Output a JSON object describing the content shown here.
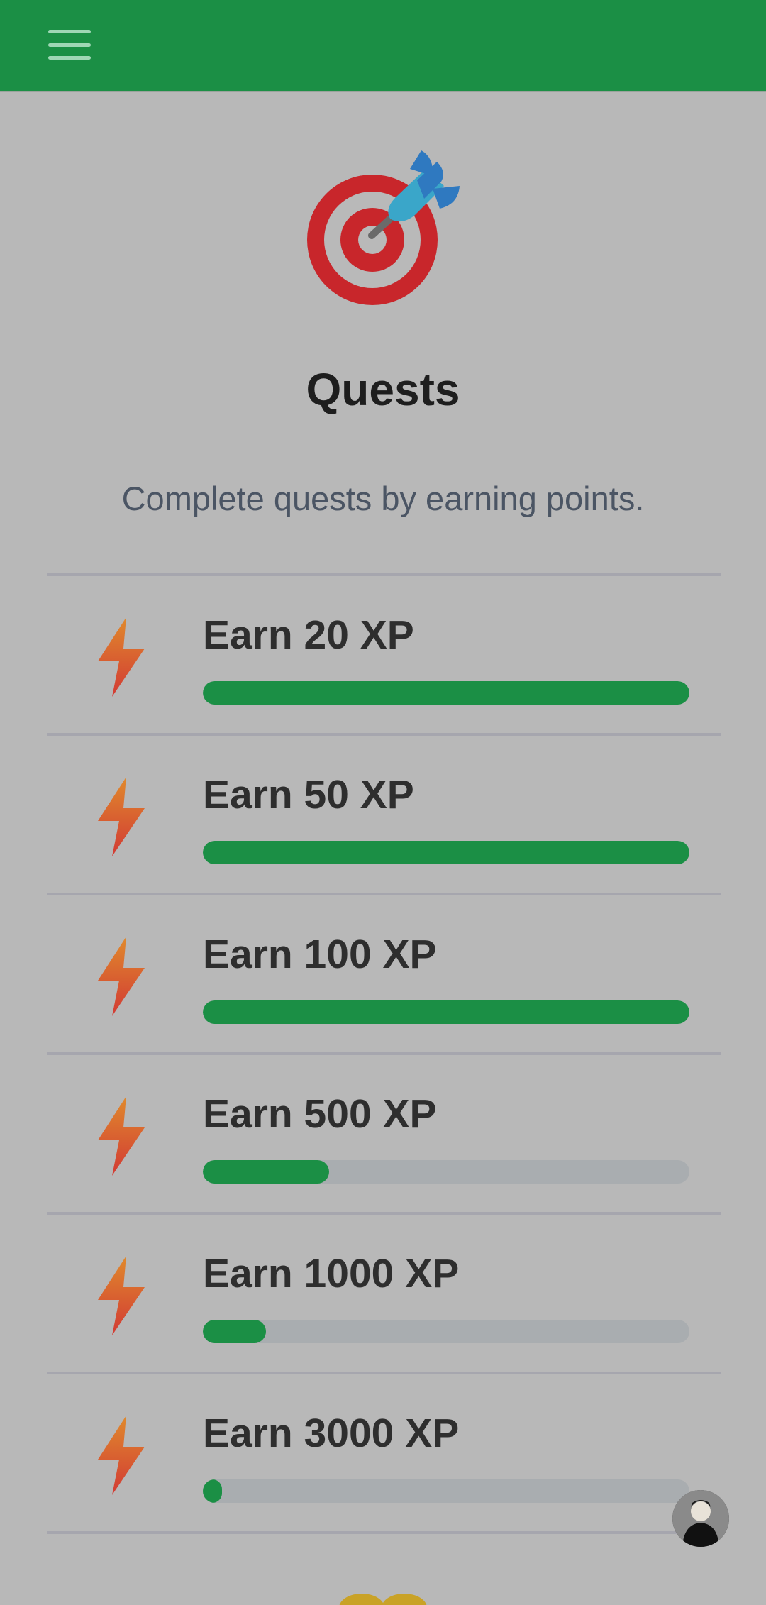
{
  "header": {
    "menu_icon": "hamburger-menu-icon",
    "accent": "#1b8f45"
  },
  "hero": {
    "icon": "target-dart-icon",
    "title": "Quests",
    "subtitle": "Complete quests by earning points."
  },
  "quests": [
    {
      "label": "Earn 20 XP",
      "icon": "lightning-bolt-icon",
      "progress": 1.0
    },
    {
      "label": "Earn 50 XP",
      "icon": "lightning-bolt-icon",
      "progress": 1.0
    },
    {
      "label": "Earn 100 XP",
      "icon": "lightning-bolt-icon",
      "progress": 1.0
    },
    {
      "label": "Earn 500 XP",
      "icon": "lightning-bolt-icon",
      "progress": 0.26
    },
    {
      "label": "Earn 1000 XP",
      "icon": "lightning-bolt-icon",
      "progress": 0.13
    },
    {
      "label": "Earn 3000 XP",
      "icon": "lightning-bolt-icon",
      "progress": 0.04
    }
  ],
  "floating": {
    "avatar": "user-avatar"
  }
}
